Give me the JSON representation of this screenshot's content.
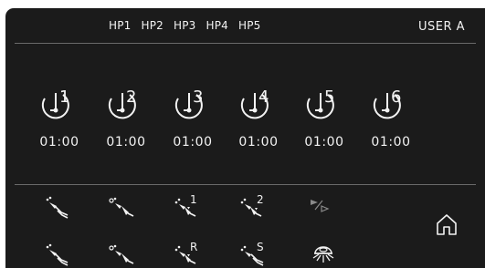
{
  "header": {
    "hp_labels": [
      "HP1",
      "HP2",
      "HP3",
      "HP4",
      "HP5"
    ],
    "user": "USER A"
  },
  "timers": [
    {
      "number": "1",
      "value": "01:00"
    },
    {
      "number": "2",
      "value": "01:00"
    },
    {
      "number": "3",
      "value": "01:00"
    },
    {
      "number": "4",
      "value": "01:00"
    },
    {
      "number": "5",
      "value": "01:00"
    },
    {
      "number": "6",
      "value": "01:00"
    }
  ],
  "controls": {
    "row1": [
      "handpiece-icon",
      "handpiece-alt-icon",
      "handpiece-1-icon",
      "handpiece-2-icon",
      "play-step-icon"
    ],
    "row2": [
      "handpiece-icon",
      "handpiece-alt-icon",
      "handpiece-r-icon",
      "handpiece-s-icon",
      "light-icon"
    ],
    "labels": {
      "h1": "1",
      "h2": "2",
      "r": "R",
      "s": "S"
    },
    "home": "home-icon"
  },
  "colors": {
    "background": "#1b1b1b",
    "foreground": "#f2f2f2",
    "divider": "#6a6a6a"
  }
}
